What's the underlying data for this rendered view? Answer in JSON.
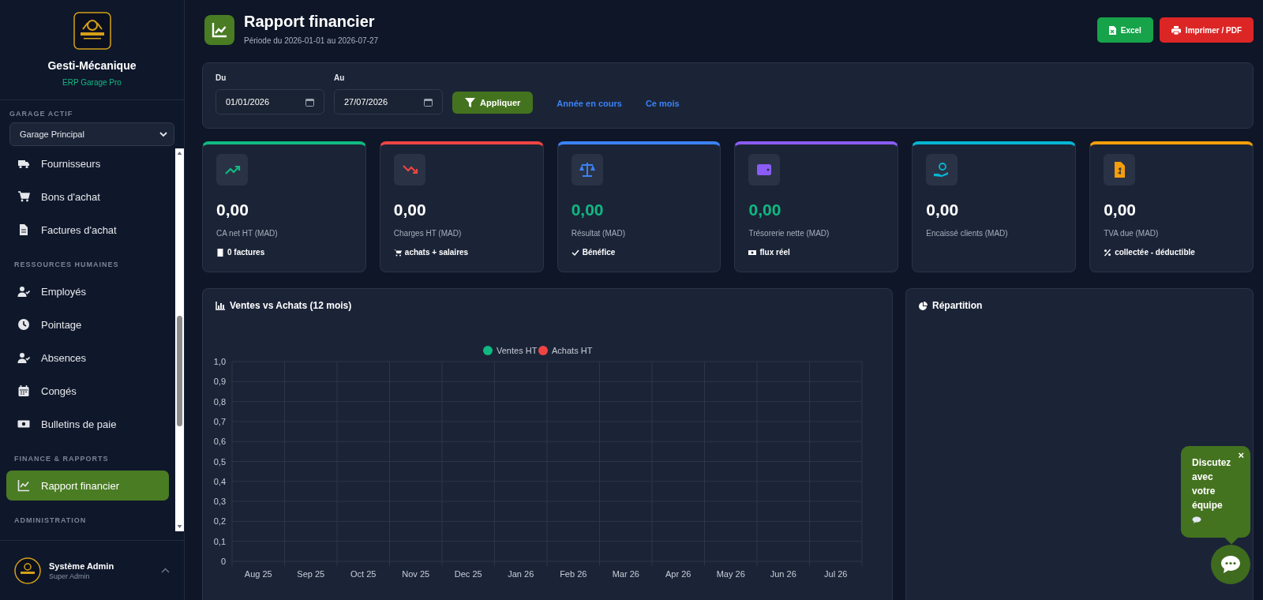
{
  "sidebar": {
    "brand": {
      "name": "Gesti-Mécanique",
      "tagline": "ERP Garage Pro"
    },
    "garage": {
      "label": "GARAGE ACTIF",
      "value": "Garage Principal"
    },
    "sections": [
      {
        "items": [
          {
            "label": "Fournisseurs",
            "selected": false
          },
          {
            "label": "Bons d'achat",
            "selected": false
          },
          {
            "label": "Factures d'achat",
            "selected": false
          }
        ]
      },
      {
        "title": "RESSOURCES HUMAINES",
        "items": [
          {
            "label": "Employés",
            "selected": false
          },
          {
            "label": "Pointage",
            "selected": false
          },
          {
            "label": "Absences",
            "selected": false
          },
          {
            "label": "Congés",
            "selected": false
          },
          {
            "label": "Bulletins de paie",
            "selected": false
          }
        ]
      },
      {
        "title": "FINANCE & RAPPORTS",
        "items": [
          {
            "label": "Rapport financier",
            "selected": true
          }
        ]
      },
      {
        "title": "ADMINISTRATION"
      }
    ],
    "user": {
      "name": "Système Admin",
      "role": "Super Admin"
    }
  },
  "header": {
    "title": "Rapport financier",
    "subtitle": "Période du 2026-01-01 au 2026-07-27",
    "buttons": [
      {
        "label": "Excel",
        "color": "#16a34a"
      },
      {
        "label": "Imprimer / PDF",
        "color": "#dc2626"
      }
    ]
  },
  "filters": {
    "from": {
      "label": "Du",
      "value": "01/01/2026"
    },
    "to": {
      "label": "Au",
      "value": "27/07/2026"
    },
    "apply": "Appliquer",
    "links": [
      "Année en cours",
      "Ce mois"
    ]
  },
  "kpis": [
    {
      "value": "0,00",
      "label": "CA net HT (MAD)",
      "note": "0 factures",
      "color": "#10b981",
      "positive": false
    },
    {
      "value": "0,00",
      "label": "Charges HT (MAD)",
      "note": "achats + salaires",
      "color": "#ef4444",
      "positive": false
    },
    {
      "value": "0,00",
      "label": "Résultat (MAD)",
      "note": "Bénéfice",
      "color": "#3b82f6",
      "positive": true
    },
    {
      "value": "0,00",
      "label": "Trésorerie nette (MAD)",
      "note": "flux réel",
      "color": "#8b5cf6",
      "positive": true
    },
    {
      "value": "0,00",
      "label": "Encaissé clients (MAD)",
      "color": "#06b6d4",
      "positive": false
    },
    {
      "value": "0,00",
      "label": "TVA due (MAD)",
      "note": "collectée - déductible",
      "color": "#f59e0b",
      "positive": false
    }
  ],
  "sales_panel": {
    "title": "Ventes vs Achats (12 mois)",
    "chart_data": {
      "type": "line",
      "categories": [
        "Aug 25",
        "Sep 25",
        "Oct 25",
        "Nov 25",
        "Dec 25",
        "Jan 26",
        "Feb 26",
        "Mar 26",
        "Apr 26",
        "May 26",
        "Jun 26",
        "Jul 26"
      ],
      "series": [
        {
          "name": "Ventes HT",
          "color": "#10b981",
          "values": [
            null,
            null,
            null,
            null,
            null,
            null,
            null,
            null,
            null,
            null,
            null,
            null
          ]
        },
        {
          "name": "Achats HT",
          "color": "#ef4444",
          "values": [
            null,
            null,
            null,
            null,
            null,
            null,
            null,
            null,
            null,
            null,
            null,
            null
          ]
        }
      ],
      "grid": true,
      "legend": true,
      "ylim": [
        0,
        1
      ],
      "yticks": [
        {
          "value": 0,
          "label": "0"
        },
        {
          "value": 0.1,
          "label": "0,1"
        },
        {
          "value": 0.2,
          "label": "0,2"
        },
        {
          "value": 0.3,
          "label": "0,3"
        },
        {
          "value": 0.4,
          "label": "0,4"
        },
        {
          "value": 0.5,
          "label": "0,5"
        },
        {
          "value": 0.6,
          "label": "0,6"
        },
        {
          "value": 0.7,
          "label": "0,7"
        },
        {
          "value": 0.8,
          "label": "0,8"
        },
        {
          "value": 0.9,
          "label": "0,9"
        },
        {
          "value": 1,
          "label": "1,0"
        }
      ]
    }
  },
  "split_panel": {
    "title": "Répartition"
  },
  "chat": {
    "prompt": "Discutez avec votre équipe",
    "close": "×"
  }
}
